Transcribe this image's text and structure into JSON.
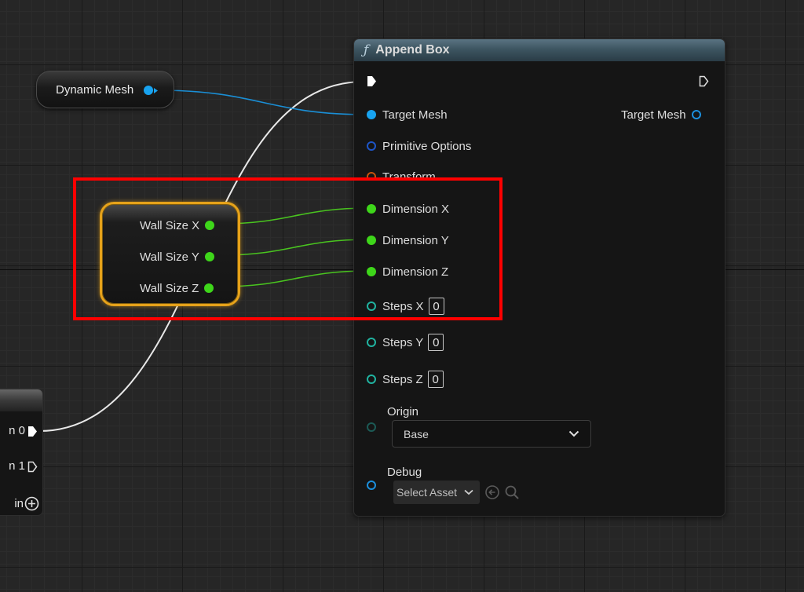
{
  "function_node": {
    "title": "Append Box",
    "inputs": {
      "target_mesh": "Target Mesh",
      "primitive_options": "Primitive Options",
      "transform": "Transform",
      "dimension_x": "Dimension X",
      "dimension_y": "Dimension Y",
      "dimension_z": "Dimension Z",
      "steps_x": "Steps X",
      "steps_y": "Steps Y",
      "steps_z": "Steps Z",
      "origin": "Origin",
      "debug": "Debug"
    },
    "outputs": {
      "target_mesh": "Target Mesh"
    },
    "values": {
      "steps_x": "0",
      "steps_y": "0",
      "steps_z": "0",
      "origin_selected": "Base",
      "debug_asset": "Select Asset"
    }
  },
  "dynamic_mesh_node": {
    "label": "Dynamic Mesh"
  },
  "wall_size_node": {
    "x": "Wall Size X",
    "y": "Wall Size Y",
    "z": "Wall Size Z"
  },
  "left_node": {
    "pin_0": "n 0",
    "pin_1": "n 1",
    "pin_add": "in"
  },
  "colors": {
    "object_pin": "#18a3f0",
    "float_pin": "#3ed61a",
    "int_pin": "#20b3a0",
    "highlight": "#ff0000",
    "variable_outline": "#e6a21a"
  },
  "icons": [
    "function-icon",
    "exec-pin-icon",
    "chevron-down-icon",
    "browse-arrow-icon",
    "search-icon",
    "add-pin-icon"
  ]
}
